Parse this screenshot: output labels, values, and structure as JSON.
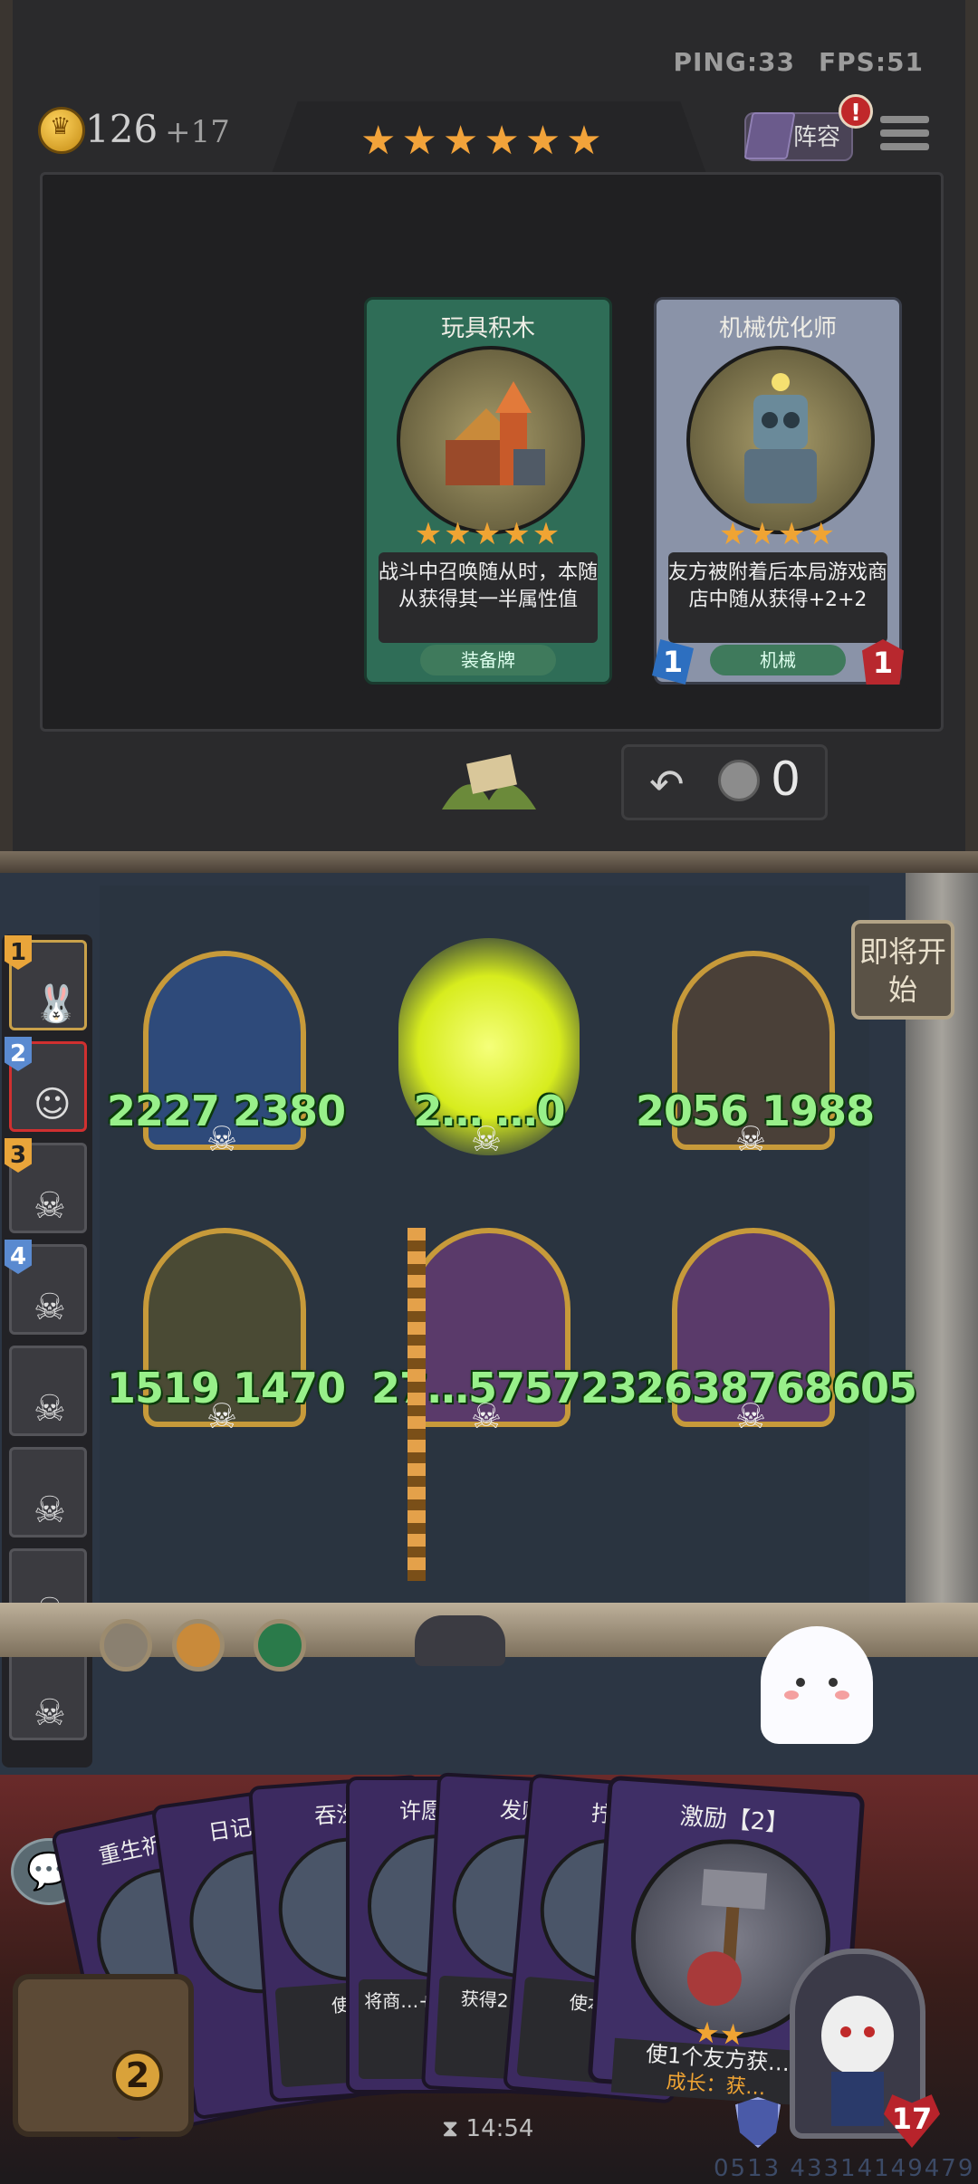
{
  "status": {
    "ping": "PING:33",
    "fps": "FPS:51"
  },
  "gold": {
    "value": "126",
    "income": "+17"
  },
  "tavern_stars": "★★★★★★",
  "lineup_button": "阵容",
  "alert_badge": "!",
  "shop_cards": [
    {
      "title": "玩具积木",
      "stars": "★★★★★",
      "desc": "战斗中召唤随从时，本随从获得其一半属性值",
      "tag": "装备牌",
      "color": "#2f6d57"
    },
    {
      "title": "机械优化师",
      "stars": "★★★★",
      "desc": "友方被附着后本局游戏商店中随从获得+2+2",
      "tag": "机械",
      "atk": "1",
      "hp": "1",
      "color": "#8a93a8"
    }
  ],
  "refresh_cost": "0",
  "start_button": "即将开始",
  "players": [
    {
      "rank": "1"
    },
    {
      "rank": "2"
    },
    {
      "rank": "3"
    },
    {
      "rank": "4"
    },
    {
      "rank": ""
    },
    {
      "rank": ""
    },
    {
      "rank": ""
    },
    {
      "rank": ""
    }
  ],
  "board_minions": [
    {
      "stats": "2227 2380"
    },
    {
      "stats": "2… …0"
    },
    {
      "stats": "2056 1988"
    },
    {
      "stats": "1519 1470"
    },
    {
      "stats": "27…5757231…"
    },
    {
      "stats": "2638768605"
    }
  ],
  "hand_cards": [
    {
      "title": "重生祈…",
      "desc": ""
    },
    {
      "title": "日记本",
      "desc": ""
    },
    {
      "title": "吞没",
      "desc": "使…"
    },
    {
      "title": "许愿…",
      "desc": "将商…+1星随…"
    },
    {
      "title": "发财",
      "desc": "获得2…金…"
    },
    {
      "title": "拧紧",
      "desc": "使本…"
    }
  ],
  "featured_hand_card": {
    "title": "激励【2】",
    "stars": "★★",
    "desc": "使1个友方获…",
    "keyword": "成长：获…"
  },
  "chest_count": "2",
  "timer": "14:54",
  "hero_hp": "17",
  "seed": "0513 43314149479"
}
